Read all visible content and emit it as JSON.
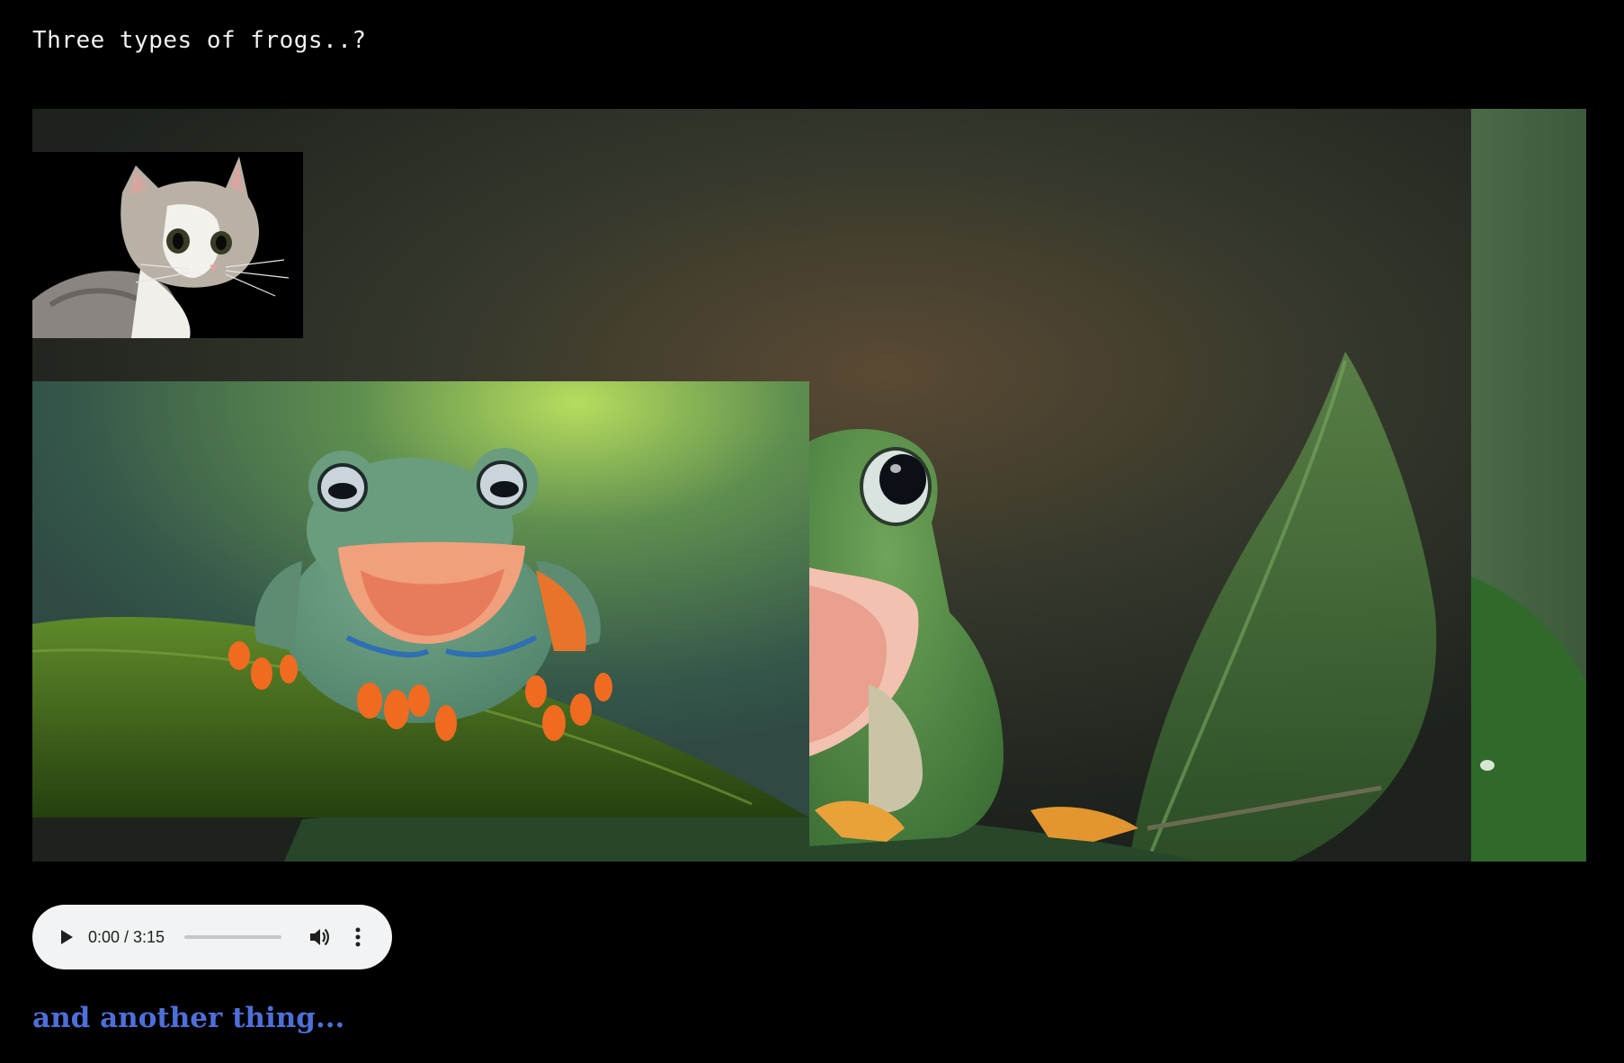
{
  "page": {
    "heading": "Three types of frogs..?",
    "footer_heading": "and another thing..."
  },
  "images": {
    "background": {
      "subject": "frog-closeup-photo"
    },
    "cat": {
      "subject": "cat-photo"
    },
    "frog_moss": {
      "subject": "frog-on-moss-photo"
    }
  },
  "audio": {
    "time_display": "0:00 / 3:15",
    "progress": 0,
    "play_icon": "play-icon",
    "volume_icon": "volume-icon",
    "more_icon": "more-vert-icon"
  },
  "colors": {
    "background": "#000000",
    "heading": "#f2f2f2",
    "footer_heading": "#4f6fd8",
    "player_bg": "#f1f3f4"
  }
}
